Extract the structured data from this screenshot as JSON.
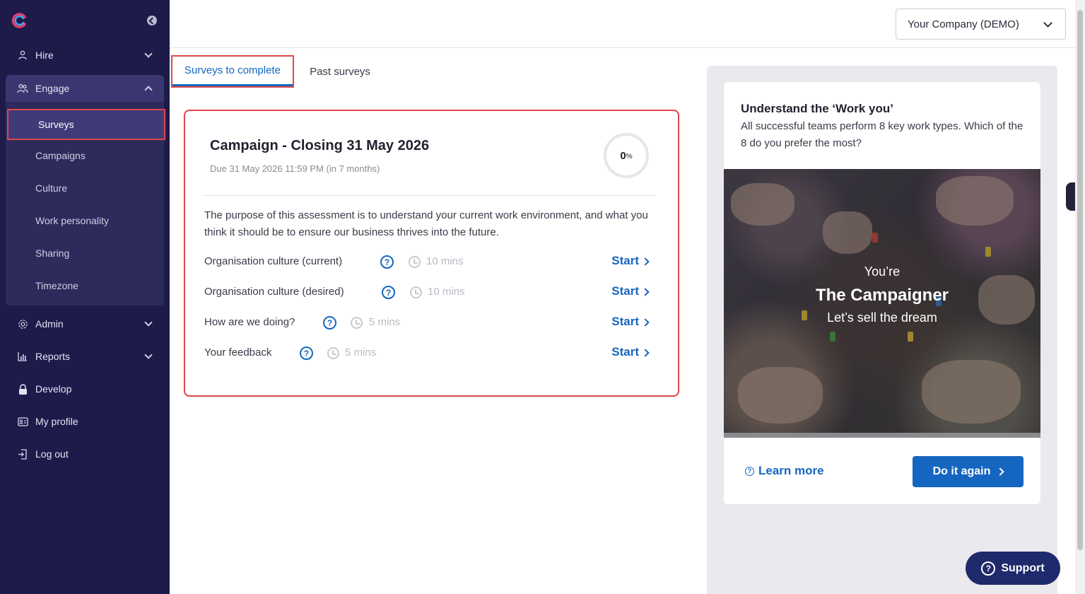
{
  "sidebar": {
    "items": [
      {
        "label": "Hire",
        "icon": "person-icon"
      },
      {
        "label": "Engage",
        "icon": "people-icon"
      },
      {
        "label": "Admin",
        "icon": "gear-icon"
      },
      {
        "label": "Reports",
        "icon": "bar-chart-icon"
      },
      {
        "label": "Develop",
        "icon": "lock-icon"
      },
      {
        "label": "My profile",
        "icon": "id-card-icon"
      },
      {
        "label": "Log out",
        "icon": "logout-icon"
      }
    ],
    "engage_sub": [
      "Surveys",
      "Campaigns",
      "Culture",
      "Work personality",
      "Sharing",
      "Timezone"
    ],
    "active_sub": "Surveys"
  },
  "header": {
    "company": "Your Company (DEMO)"
  },
  "tabs": {
    "active": "Surveys to complete",
    "other": "Past surveys"
  },
  "campaign": {
    "title": "Campaign - Closing 31 May 2026",
    "due": "Due 31 May 2026 11:59 PM (in 7 months)",
    "progress_value": "0",
    "progress_unit": "%",
    "description": "The purpose of this assessment is to understand your current work environment, and what you think it should be to ensure our business thrives into the future.",
    "surveys": [
      {
        "name": "Organisation culture (current)",
        "duration": "10 mins",
        "action": "Start"
      },
      {
        "name": "Organisation culture (desired)",
        "duration": "10 mins",
        "action": "Start"
      },
      {
        "name": "How are we doing?",
        "duration": "5 mins",
        "action": "Start"
      },
      {
        "name": "Your feedback",
        "duration": "5 mins",
        "action": "Start"
      }
    ]
  },
  "work_you": {
    "title": "Understand the ‘Work you’",
    "description": "All successful teams perform 8 key work types. Which of the 8 do you prefer the most?",
    "image_line1": "You’re",
    "image_line2": "The Campaigner",
    "image_line3": "Let’s sell the dream",
    "learn_more": "Learn more",
    "do_again": "Do it again"
  },
  "support": {
    "label": "Support"
  },
  "colors": {
    "sidebar_bg": "#1e1b4b",
    "accent": "#1566c0",
    "highlight": "#e04848"
  }
}
